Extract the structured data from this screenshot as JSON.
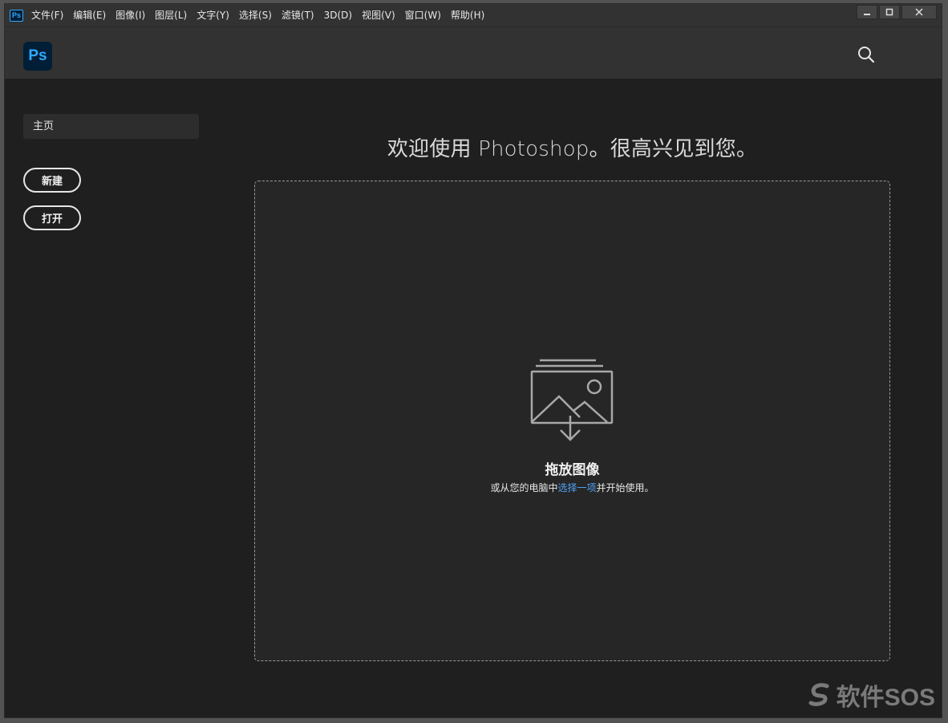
{
  "menubar": {
    "app_icon_label": "Ps",
    "items": [
      "文件(F)",
      "编辑(E)",
      "图像(I)",
      "图层(L)",
      "文字(Y)",
      "选择(S)",
      "滤镜(T)",
      "3D(D)",
      "视图(V)",
      "窗口(W)",
      "帮助(H)"
    ]
  },
  "header": {
    "logo_label": "Ps",
    "search_icon": "search-icon"
  },
  "sidebar": {
    "home_label": "主页",
    "new_label": "新建",
    "open_label": "打开"
  },
  "main": {
    "welcome": "欢迎使用 Photoshop。很高兴见到您。",
    "drop_title": "拖放图像",
    "drop_sub_prefix": "或从您的电脑中",
    "drop_sub_link": "选择一项",
    "drop_sub_suffix": "并开始使用。"
  },
  "watermark": {
    "text": "软件SOS"
  },
  "colors": {
    "accent": "#31a8ff",
    "link": "#4fa3f7",
    "background": "#1f1f1f",
    "panel": "#323232"
  }
}
